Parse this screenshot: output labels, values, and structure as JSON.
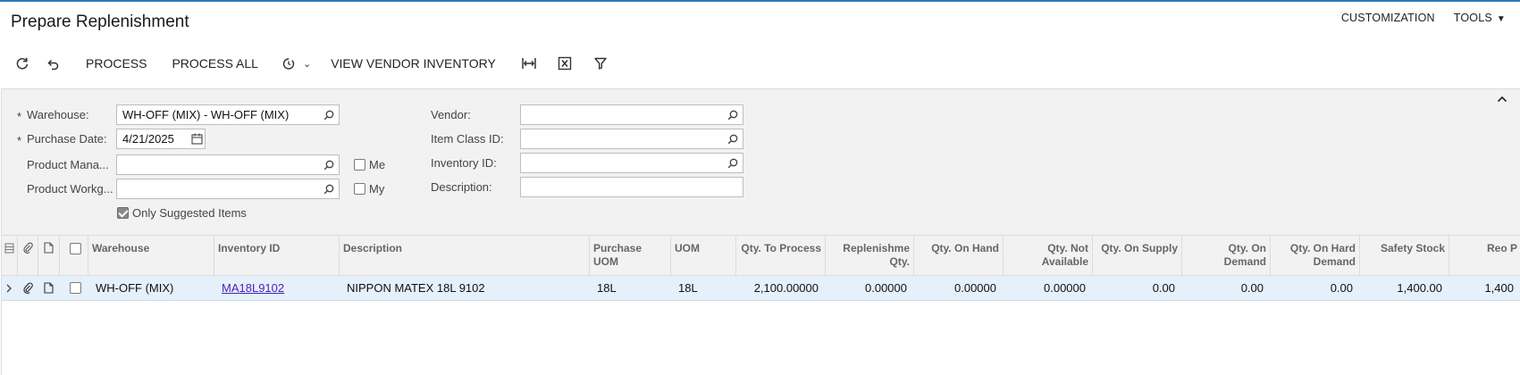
{
  "header": {
    "title": "Prepare Replenishment",
    "customization": "CUSTOMIZATION",
    "tools": "TOOLS"
  },
  "toolbar": {
    "process": "PROCESS",
    "process_all": "PROCESS ALL",
    "view_vendor_inventory": "VIEW VENDOR INVENTORY"
  },
  "filters": {
    "warehouse_label": "Warehouse:",
    "warehouse_value": "WH-OFF (MIX) - WH-OFF (MIX)",
    "purchase_date_label": "Purchase Date:",
    "purchase_date_value": "4/21/2025",
    "product_manager_label": "Product Mana...",
    "product_manager_value": "",
    "me_label": "Me",
    "product_workgroup_label": "Product Workg...",
    "product_workgroup_value": "",
    "my_label": "My",
    "only_suggested_label": "Only Suggested Items",
    "only_suggested_checked": true,
    "vendor_label": "Vendor:",
    "vendor_value": "",
    "item_class_label": "Item Class ID:",
    "item_class_value": "",
    "inventory_id_label": "Inventory ID:",
    "inventory_id_value": "",
    "description_label": "Description:",
    "description_value": ""
  },
  "grid": {
    "columns": {
      "warehouse": "Warehouse",
      "inventory_id": "Inventory ID",
      "description": "Description",
      "purchase_uom": "Purchase UOM",
      "uom": "UOM",
      "qty_to_process": "Qty. To Process",
      "replenishment_qty": "Replenishme Qty.",
      "qty_on_hand": "Qty. On Hand",
      "qty_not_available": "Qty. Not Available",
      "qty_on_supply": "Qty. On Supply",
      "qty_on_demand": "Qty. On Demand",
      "qty_on_hard_demand": "Qty. On Hard Demand",
      "safety_stock": "Safety Stock",
      "reorder_point": "Reo P"
    },
    "rows": [
      {
        "warehouse": "WH-OFF (MIX)",
        "inventory_id": "MA18L9102",
        "description": "NIPPON MATEX 18L 9102",
        "purchase_uom": "18L",
        "uom": "18L",
        "qty_to_process": "2,100.00000",
        "replenishment_qty": "0.00000",
        "qty_on_hand": "0.00000",
        "qty_not_available": "0.00000",
        "qty_on_supply": "0.00",
        "qty_on_demand": "0.00",
        "qty_on_hard_demand": "0.00",
        "safety_stock": "1,400.00",
        "reorder_point": "1,400"
      }
    ]
  },
  "colors": {
    "accent": "#2d7ab5",
    "link": "#4a1fb8",
    "row_selected": "#e5f0fb",
    "panel_bg": "#f2f2f2"
  },
  "icons": [
    "refresh-icon",
    "undo-icon",
    "schedule-icon",
    "fit-columns-icon",
    "excel-icon",
    "filter-icon",
    "search-icon",
    "calendar-icon",
    "collapse-icon",
    "attach-icon",
    "note-icon"
  ]
}
